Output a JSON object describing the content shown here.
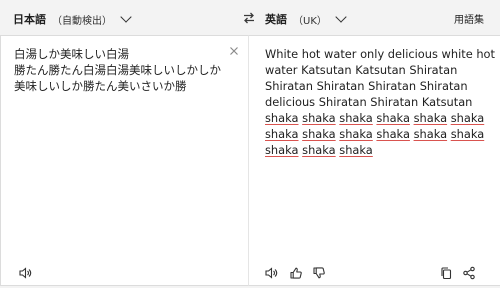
{
  "source": {
    "language": "日本語",
    "detected_label": "（自動検出）",
    "text_lines": [
      "白湯しか美味しい白湯",
      "勝たん勝たん白湯白湯美味しいしかしか",
      "美味しいしか勝たん美いさいか勝"
    ]
  },
  "target": {
    "language": "英語",
    "region": "（UK）",
    "glossary_label": "用語集",
    "text_plain": "White hot water only delicious white hot water Katsutan Katsutan Shiratan Shiratan Shiratan Shiratan Shiratan delicious Shiratan Shiratan Katsutan ",
    "text_underlined_words": [
      "shaka",
      "shaka",
      "shaka",
      "shaka",
      "shaka",
      "shaka",
      "shaka",
      "shaka",
      "shaka",
      "shaka",
      "shaka",
      "shaka",
      "shaka",
      "shaka",
      "shaka"
    ]
  },
  "icons": {
    "swap": "swap-arrows-icon",
    "clear": "close-icon",
    "speak_source": "speaker-icon",
    "speak_target": "speaker-icon",
    "like": "thumbs-up-icon",
    "dislike": "thumbs-down-icon",
    "copy": "copy-icon",
    "share": "share-icon"
  }
}
